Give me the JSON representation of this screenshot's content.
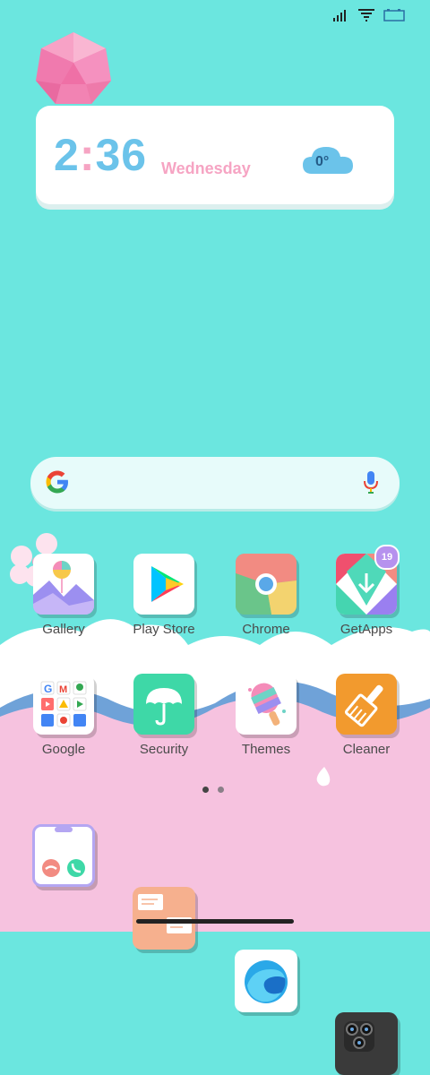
{
  "widget": {
    "hours": "2",
    "colon": ":",
    "minutes": "36",
    "day": "Wednesday",
    "temperature": "0°"
  },
  "apps_row1": [
    {
      "label": "Gallery"
    },
    {
      "label": "Play Store"
    },
    {
      "label": "Chrome"
    },
    {
      "label": "GetApps",
      "badge": "19"
    }
  ],
  "apps_row2": [
    {
      "label": "Google"
    },
    {
      "label": "Security"
    },
    {
      "label": "Themes"
    },
    {
      "label": "Cleaner"
    }
  ],
  "dock": [
    {
      "icon": "phone-icon"
    },
    {
      "icon": "messages-icon"
    },
    {
      "icon": "browser-icon"
    },
    {
      "icon": "camera-icon"
    }
  ],
  "pages": {
    "count": 2,
    "active": 1
  },
  "colors": {
    "background_top": "#6be6df",
    "wave_pink": "#f6c2df",
    "widget_accent": "#6bc3ea",
    "widget_pink": "#f6a4c3"
  }
}
